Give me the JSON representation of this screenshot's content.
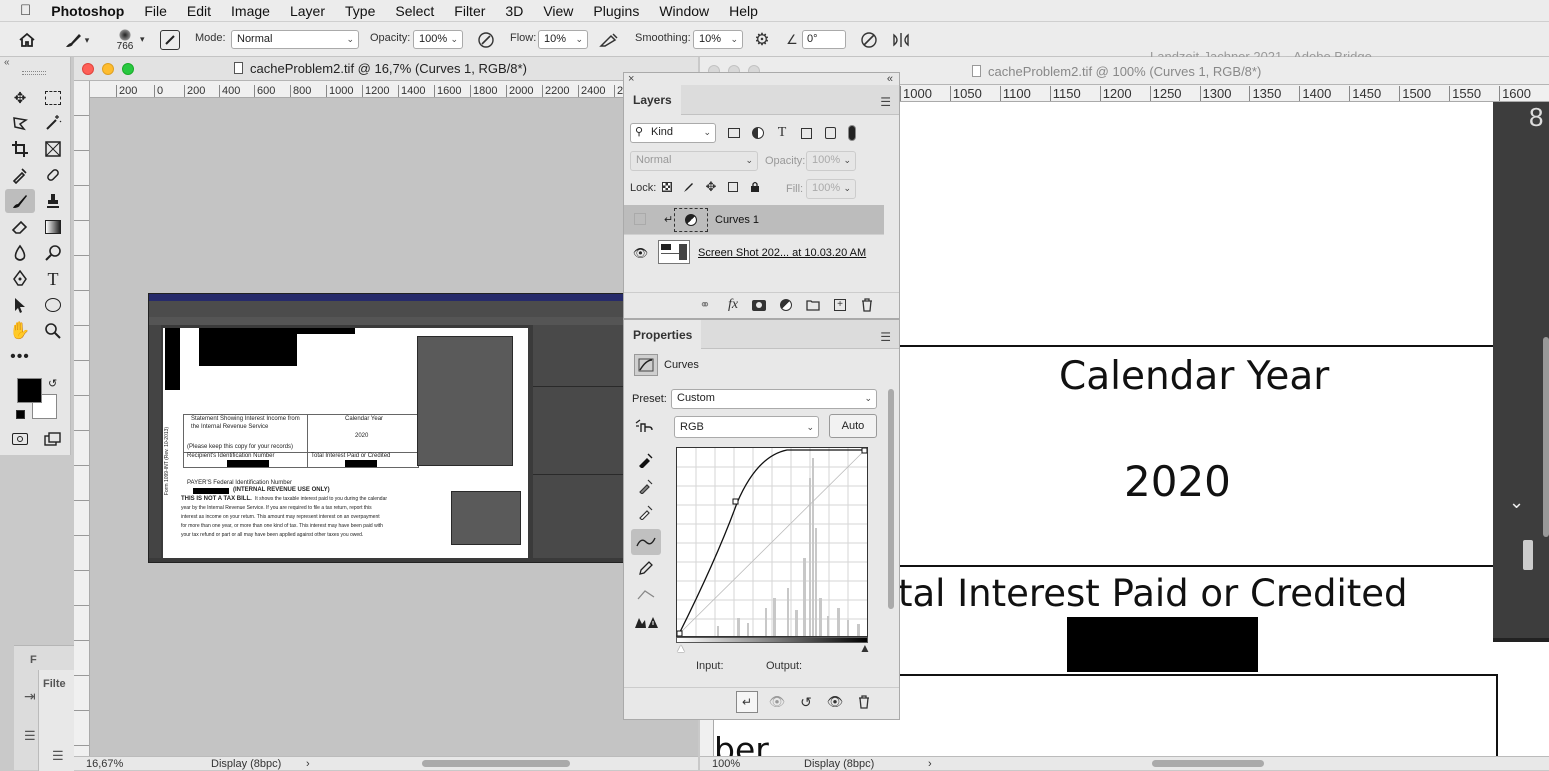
{
  "menubar": {
    "apple": "",
    "app": "Photoshop",
    "items": [
      "File",
      "Edit",
      "Image",
      "Layer",
      "Type",
      "Select",
      "Filter",
      "3D",
      "View",
      "Plugins",
      "Window",
      "Help"
    ]
  },
  "options": {
    "brush_size": "766",
    "mode_label": "Mode:",
    "mode_value": "Normal",
    "opacity_label": "Opacity:",
    "opacity_value": "100%",
    "flow_label": "Flow:",
    "flow_value": "10%",
    "smoothing_label": "Smoothing:",
    "smoothing_value": "10%",
    "angle_value": "0°"
  },
  "doc1": {
    "title": "cacheProblem2.tif @ 16,7% (Curves 1, RGB/8*)",
    "ruler": [
      "200",
      "0",
      "200",
      "400",
      "600",
      "800",
      "1000",
      "1200",
      "1400",
      "1600",
      "1800",
      "2000",
      "2200",
      "2400",
      "2600"
    ],
    "zoom": "16,67%",
    "display": "Display (8bpc)"
  },
  "doc2": {
    "title": "cacheProblem2.tif @ 100% (Curves 1, RGB/8*)",
    "bg_title": "Landzeit-Jachner 2021 - Adobe Bridge",
    "ruler": [
      "1000",
      "1050",
      "1100",
      "1150",
      "1200",
      "1250",
      "1300",
      "1350",
      "1400",
      "1450",
      "1500",
      "1550",
      "1600"
    ],
    "zoom": "100%",
    "display": "Display (8bpc)",
    "text_calendar": "Calendar Year",
    "text_year": "2020",
    "text_interest": "tal Interest Paid or Credited",
    "text_bottom": "ber"
  },
  "layers": {
    "tab": "Layers",
    "kind": "Kind",
    "blend": "Normal",
    "opacity_label": "Opacity:",
    "opacity_value": "100%",
    "lock_label": "Lock:",
    "fill_label": "Fill:",
    "fill_value": "100%",
    "items": [
      {
        "name": "Curves 1"
      },
      {
        "name": "Screen Shot 202... at 10.03.20 AM"
      }
    ]
  },
  "properties": {
    "tab": "Properties",
    "type": "Curves",
    "preset_label": "Preset:",
    "preset_value": "Custom",
    "channel": "RGB",
    "auto": "Auto",
    "input_label": "Input:",
    "output_label": "Output:"
  },
  "embedded": {
    "line1": "Statement Showing Interest Income from",
    "line2": "the Internal Revenue Service",
    "cal": "Calendar Year",
    "year": "2020",
    "keep": "(Please keep this copy for your records)",
    "recip": "Recipient's Identification Number",
    "total": "Total Interest Paid or Credited",
    "payer": "PAYER'S Federal Identification Number",
    "irs": "(INTERNAL REVENUE USE ONLY)",
    "bold": "THIS IS NOT A TAX BILL.",
    "p1": "It shows the taxable interest paid to you during the calendar",
    "p2": "year by the Internal Revenue Service. If you are required to file a tax return, report this",
    "p3": "interest as income on your return. This amount may represent interest on an overpayment",
    "p4": "for more than one year, or more than one kind of tax. This interest may have been paid with",
    "p5": "your tax refund or part or all may have been applied against other taxes you owed.",
    "form": "Form 1099-INT (Rev. 10-2013)"
  },
  "left_panel": {
    "f": "F",
    "filter": "Filte"
  }
}
